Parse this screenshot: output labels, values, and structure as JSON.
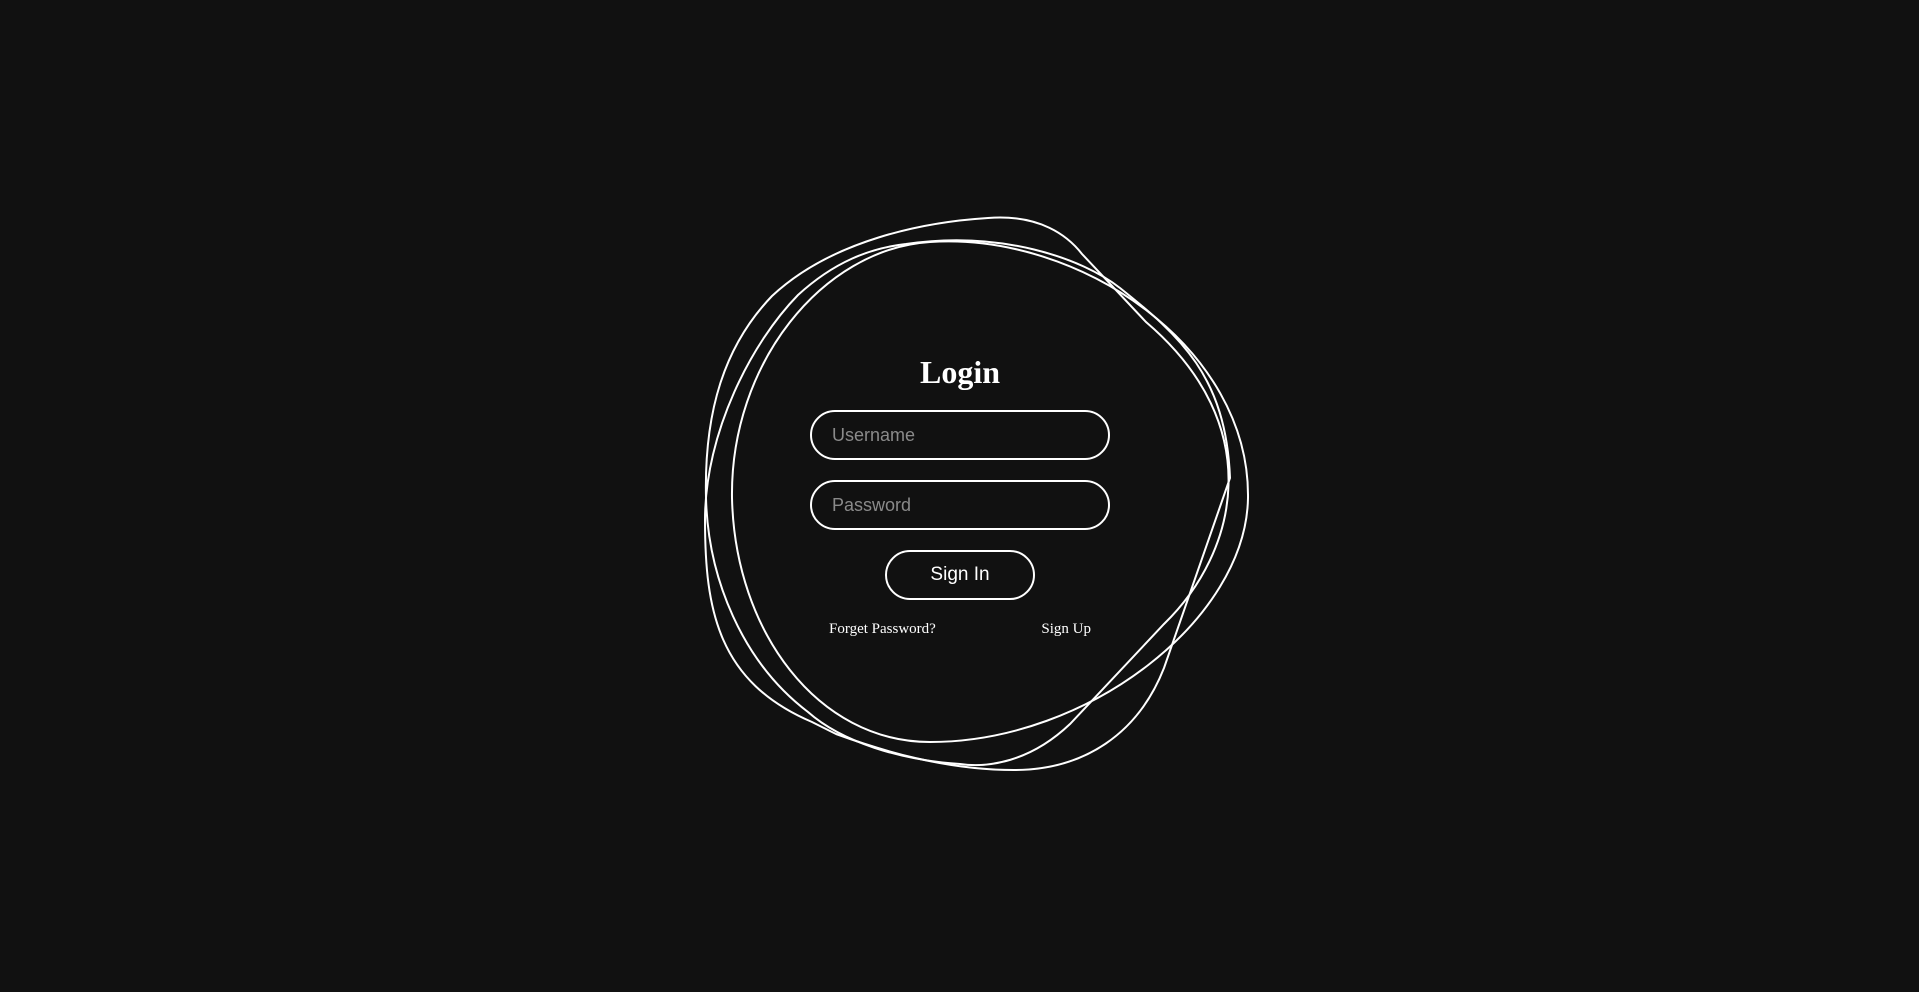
{
  "login": {
    "title": "Login",
    "username_placeholder": "Username",
    "password_placeholder": "Password",
    "signin_label": "Sign In",
    "forgot_label": "Forget Password?",
    "signup_label": "Sign Up"
  },
  "colors": {
    "background": "#111111",
    "foreground": "#ffffff",
    "placeholder": "#8a8a8a"
  }
}
